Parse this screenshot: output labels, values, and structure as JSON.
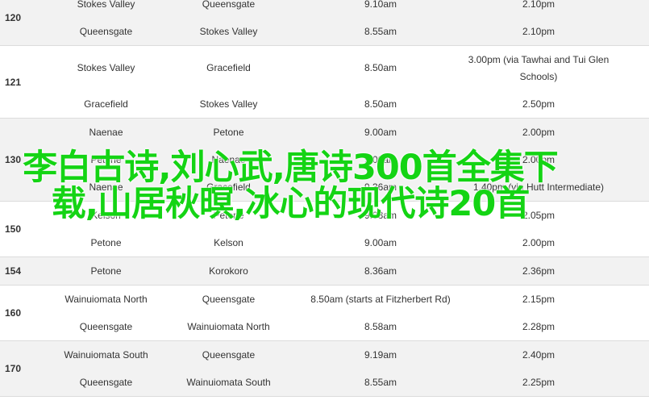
{
  "groups": [
    {
      "route": "120",
      "shade": "shaded",
      "rows": [
        {
          "from": "Stokes Valley",
          "to": "Queensgate",
          "depart": "9.10am",
          "time": "2.10pm"
        },
        {
          "from": "Queensgate",
          "to": "Stokes Valley",
          "depart": "8.55am",
          "time": "2.10pm"
        }
      ]
    },
    {
      "route": "121",
      "shade": "plain",
      "rows": [
        {
          "from": "Stokes Valley",
          "to": "Gracefield",
          "depart": "8.50am",
          "time": "3.00pm (via Tawhai and Tui Glen Schools)",
          "tall": true
        },
        {
          "from": "Gracefield",
          "to": "Stokes Valley",
          "depart": "8.50am",
          "time": "2.50pm"
        }
      ]
    },
    {
      "route": "130",
      "shade": "shaded",
      "rows": [
        {
          "from": "Naenae",
          "to": "Petone",
          "depart": "9.00am",
          "time": "2.00pm"
        },
        {
          "from": "Petone",
          "to": "Naenae",
          "depart": "9.00am",
          "time": "2.00pm"
        },
        {
          "from": "Naenae",
          "to": "Gracefield",
          "depart": "9.36am",
          "time": "1.40pm (via Hutt Intermediate)"
        }
      ]
    },
    {
      "route": "150",
      "shade": "plain",
      "rows": [
        {
          "from": "Kelson",
          "to": "Petone",
          "depart": "9.03am",
          "time": "2.05pm"
        },
        {
          "from": "Petone",
          "to": "Kelson",
          "depart": "9.00am",
          "time": "2.00pm"
        }
      ]
    },
    {
      "route": "154",
      "shade": "shaded",
      "rows": [
        {
          "from": "Petone",
          "to": "Korokoro",
          "depart": "8.36am",
          "time": "2.36pm"
        }
      ]
    },
    {
      "route": "160",
      "shade": "plain",
      "rows": [
        {
          "from": "Wainuiomata North",
          "to": "Queensgate",
          "depart": "8.50am (starts at Fitzherbert Rd)",
          "time": "2.15pm"
        },
        {
          "from": "Queensgate",
          "to": "Wainuiomata North",
          "depart": "8.58am",
          "time": "2.28pm"
        }
      ]
    },
    {
      "route": "170",
      "shade": "shaded",
      "rows": [
        {
          "from": "Wainuiomata South",
          "to": "Queensgate",
          "depart": "9.19am",
          "time": "2.40pm"
        },
        {
          "from": "Queensgate",
          "to": "Wainuiomata South",
          "depart": "8.55am",
          "time": "2.25pm"
        }
      ]
    }
  ],
  "overlay_text": "李白古诗,刘心武,唐诗300首全集下载,山居秋暝,冰心的现代诗20首",
  "colors": {
    "overlay": "#14d414",
    "shaded_row": "#f2f2f2",
    "text": "#333333"
  }
}
